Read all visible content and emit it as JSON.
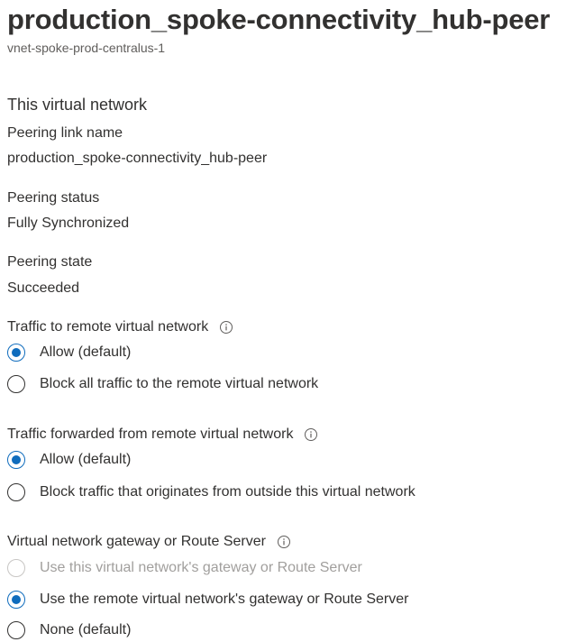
{
  "header": {
    "title": "production_spoke-connectivity_hub-peer",
    "subtitle": "vnet-spoke-prod-centralus-1"
  },
  "section": {
    "heading": "This virtual network"
  },
  "fields": {
    "peering_link_name": {
      "label": "Peering link name",
      "value": "production_spoke-connectivity_hub-peer"
    },
    "peering_status": {
      "label": "Peering status",
      "value": "Fully Synchronized"
    },
    "peering_state": {
      "label": "Peering state",
      "value": "Succeeded"
    }
  },
  "traffic_to_remote": {
    "label": "Traffic to remote virtual network",
    "info_icon": "info-icon",
    "options": [
      {
        "label": "Allow (default)",
        "checked": true,
        "disabled": false
      },
      {
        "label": "Block all traffic to the remote virtual network",
        "checked": false,
        "disabled": false
      }
    ]
  },
  "traffic_forwarded": {
    "label": "Traffic forwarded from remote virtual network",
    "info_icon": "info-icon",
    "options": [
      {
        "label": "Allow (default)",
        "checked": true,
        "disabled": false
      },
      {
        "label": "Block traffic that originates from outside this virtual network",
        "checked": false,
        "disabled": false
      }
    ]
  },
  "gateway": {
    "label": "Virtual network gateway or Route Server",
    "info_icon": "info-icon",
    "options": [
      {
        "label": "Use this virtual network's gateway or Route Server",
        "checked": false,
        "disabled": true
      },
      {
        "label": "Use the remote virtual network's gateway or Route Server",
        "checked": true,
        "disabled": false
      },
      {
        "label": "None (default)",
        "checked": false,
        "disabled": false
      }
    ]
  },
  "colors": {
    "accent": "#0f6cbd",
    "text": "#323130",
    "subtext": "#605e5c",
    "disabled": "#a19f9d"
  }
}
